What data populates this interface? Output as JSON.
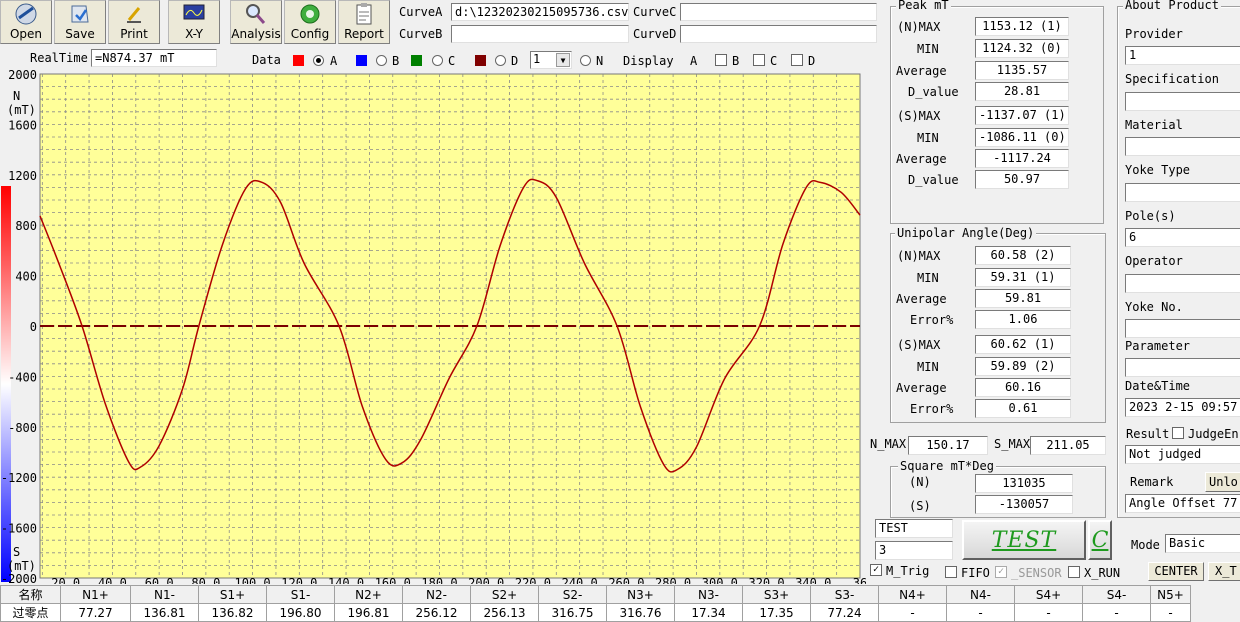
{
  "toolbar": {
    "open": "Open",
    "save": "Save",
    "print": "Print",
    "xy": "X-Y",
    "analysis": "Analysis",
    "config": "Config",
    "report": "Report"
  },
  "curves": {
    "a_label": "CurveA",
    "a_value": "d:\\12320230215095736.csv",
    "b_label": "CurveB",
    "b_value": "",
    "c_label": "CurveC",
    "c_value": "",
    "d_label": "CurveD",
    "d_value": ""
  },
  "realtime": {
    "label": "RealTime",
    "value": "=N874.37 mT"
  },
  "data_row": {
    "data_label": "Data",
    "a": "A",
    "b": "B",
    "c": "C",
    "d": "D",
    "n": "N",
    "select_value": "1",
    "display_label": "Display",
    "disp_a": "A",
    "disp_b": "B",
    "disp_c": "C",
    "disp_d": "D",
    "colors": {
      "a": "#ff0000",
      "b": "#0000ff",
      "c": "#008000",
      "d": "#800000"
    }
  },
  "axis": {
    "n_label": "N",
    "unit": "(mT)",
    "s_label": "S",
    "s_unit": "(mT)"
  },
  "peak": {
    "title": "Peak   mT",
    "n_max_label": "(N)MAX",
    "n_max": "1153.12 (1)",
    "n_min_label": "MIN",
    "n_min": "1124.32 (0)",
    "n_avg_label": "Average",
    "n_avg": "1135.57",
    "n_d_label": "D_value",
    "n_d": "28.81",
    "s_max_label": "(S)MAX",
    "s_max": "-1137.07 (1)",
    "s_min_label": "MIN",
    "s_min": "-1086.11 (0)",
    "s_avg_label": "Average",
    "s_avg": "-1117.24",
    "s_d_label": "D_value",
    "s_d": "50.97"
  },
  "unipolar": {
    "title": "Unipolar Angle(Deg)",
    "n_max_label": "(N)MAX",
    "n_max": "60.58 (2)",
    "n_min_label": "MIN",
    "n_min": "59.31 (1)",
    "n_avg_label": "Average",
    "n_avg": "59.81",
    "n_err_label": "Error%",
    "n_err": "1.06",
    "s_max_label": "(S)MAX",
    "s_max": "60.62 (1)",
    "s_min_label": "MIN",
    "s_min": "59.89 (2)",
    "s_avg_label": "Average",
    "s_avg": "60.16",
    "s_err_label": "Error%",
    "s_err": "0.61"
  },
  "maxes": {
    "n_label": "N_MAX",
    "n_value": "150.17",
    "s_label": "S_MAX",
    "s_value": "211.05"
  },
  "square": {
    "title": "Square  mT*Deg",
    "n_label": "(N)",
    "n_value": "131035",
    "s_label": "(S)",
    "s_value": "-130057"
  },
  "test": {
    "name_value": "TEST",
    "count_value": "3",
    "button": "TEST",
    "c_button": "C",
    "m_trig": "M_Trig",
    "fifo": "FIFO",
    "sensor": "_SENSOR",
    "x_run": "X_RUN",
    "center": "CENTER",
    "x_t": "X_T"
  },
  "product": {
    "title": "About Product",
    "provider_label": "Provider",
    "provider": "1",
    "spec_label": "Specification",
    "spec": "",
    "material_label": "Material",
    "material": "",
    "yoke_type_label": "Yoke Type",
    "yoke_type": "",
    "poles_label": "Pole(s)",
    "poles": "6",
    "operator_label": "Operator",
    "operator": "",
    "yoke_no_label": "Yoke No.",
    "yoke_no": "",
    "parameter_label": "Parameter",
    "parameter": "",
    "datetime_label": "Date&Time",
    "datetime": "2023 2-15 09:57",
    "result_label": "Result",
    "judge_label": "JudgeEn",
    "result": "Not judged",
    "remark_label": "Remark",
    "unlock": "Unlo",
    "remark": "Angle Offset 77.",
    "mode_label": "Mode",
    "mode": "Basic"
  },
  "bottom_table": {
    "headers": [
      "名称",
      "N1+",
      "N1-",
      "S1+",
      "S1-",
      "N2+",
      "N2-",
      "S2+",
      "S2-",
      "N3+",
      "N3-",
      "S3+",
      "S3-",
      "N4+",
      "N4-",
      "S4+",
      "S4-",
      "N5+"
    ],
    "row_label": "过零点",
    "values": [
      "77.27",
      "136.81",
      "136.82",
      "196.80",
      "196.81",
      "256.12",
      "256.13",
      "316.75",
      "316.76",
      "17.34",
      "17.35",
      "77.24",
      "-",
      "-",
      "-",
      "-",
      "-"
    ]
  },
  "chart_data": {
    "type": "line",
    "xlabel": "",
    "ylabel": "N (mT)",
    "xlim": [
      9,
      360
    ],
    "ylim": [
      -2000,
      2000
    ],
    "x_ticks": [
      "20.0",
      "40.0",
      "60.0",
      "80.0",
      "100.0",
      "120.0",
      "140.0",
      "160.0",
      "180.0",
      "200.0",
      "220.0",
      "240.0",
      "260.0",
      "280.0",
      "300.0",
      "320.0",
      "340.0",
      "36"
    ],
    "y_ticks": [
      "2000",
      "1600",
      "1200",
      "800",
      "400",
      "0",
      "-400",
      "-800",
      "-1200",
      "-1600",
      "-2000"
    ],
    "grid": true,
    "series": [
      {
        "color": "#b00000",
        "points": [
          [
            9,
            874
          ],
          [
            17,
            500
          ],
          [
            27,
            0
          ],
          [
            37,
            -620
          ],
          [
            47,
            -1080
          ],
          [
            52,
            -1120
          ],
          [
            60,
            -950
          ],
          [
            70,
            -500
          ],
          [
            77,
            0
          ],
          [
            87,
            640
          ],
          [
            97,
            1090
          ],
          [
            104,
            1140
          ],
          [
            112,
            980
          ],
          [
            122,
            500
          ],
          [
            137,
            0
          ],
          [
            147,
            -640
          ],
          [
            157,
            -1060
          ],
          [
            164,
            -1086
          ],
          [
            172,
            -900
          ],
          [
            184,
            -420
          ],
          [
            196,
            0
          ],
          [
            206,
            640
          ],
          [
            216,
            1100
          ],
          [
            222,
            1153
          ],
          [
            230,
            1020
          ],
          [
            242,
            500
          ],
          [
            256,
            0
          ],
          [
            266,
            -640
          ],
          [
            276,
            -1100
          ],
          [
            282,
            -1137
          ],
          [
            290,
            -960
          ],
          [
            302,
            -420
          ],
          [
            317,
            0
          ],
          [
            327,
            650
          ],
          [
            337,
            1100
          ],
          [
            343,
            1140
          ],
          [
            352,
            1060
          ],
          [
            360,
            880
          ]
        ]
      }
    ],
    "zero_line": 0
  }
}
